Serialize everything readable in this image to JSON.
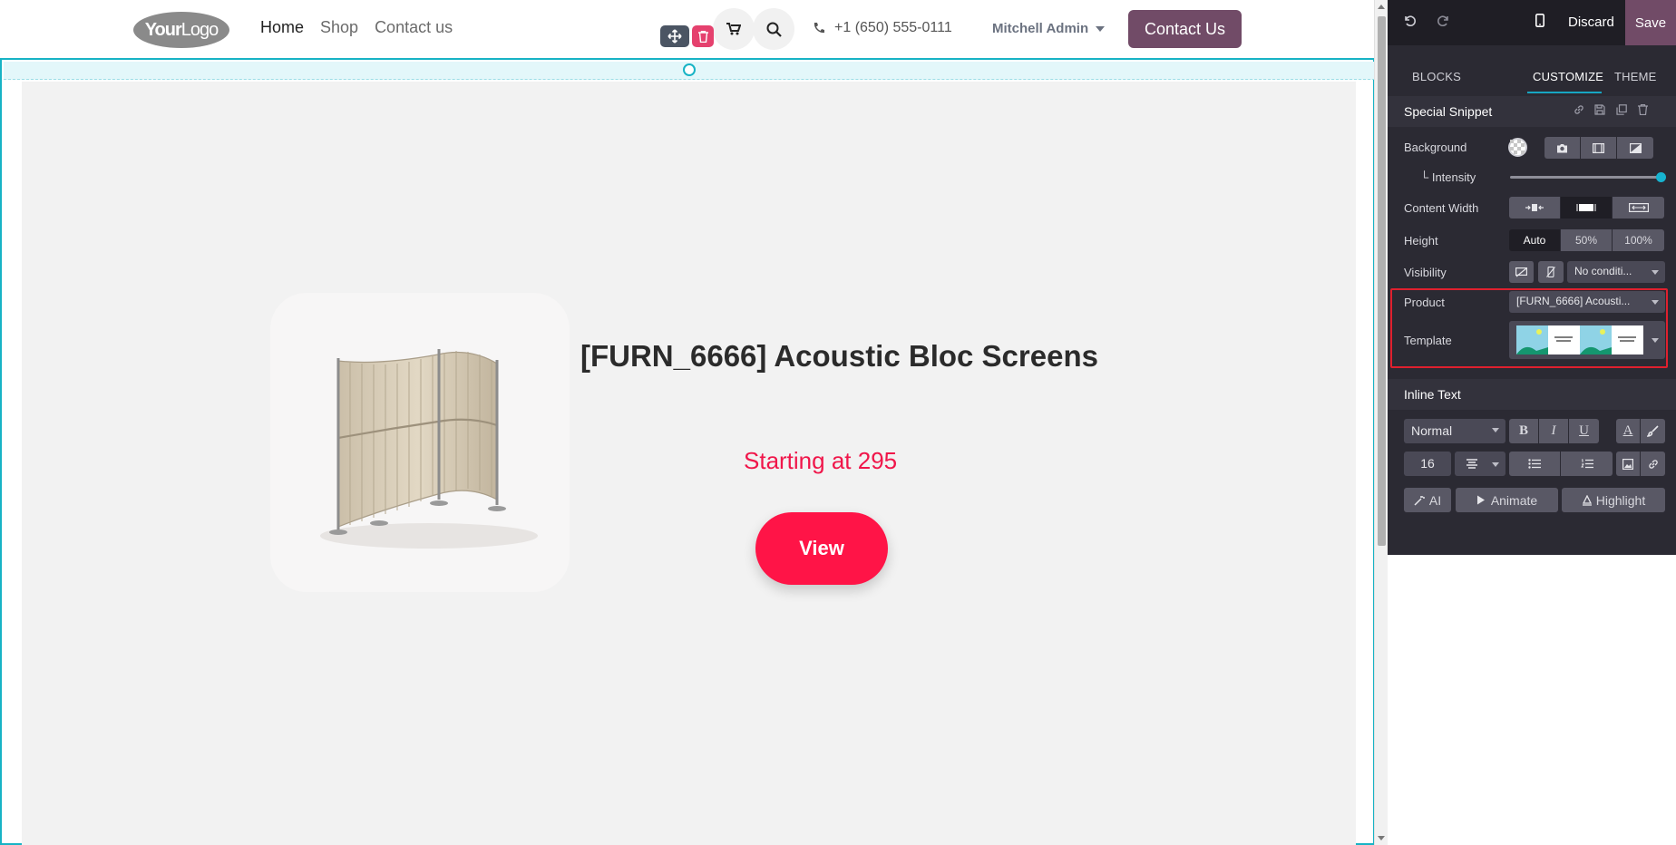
{
  "header": {
    "logo_bold": "Your",
    "logo_thin": "Logo",
    "nav": [
      "Home",
      "Shop",
      "Contact us"
    ],
    "phone": "+1 (650) 555-0111",
    "user": "Mitchell Admin",
    "cta": "Contact Us"
  },
  "product": {
    "title": "[FURN_6666] Acoustic Bloc Screens",
    "price": "Starting at 295",
    "button": "View"
  },
  "editor": {
    "discard": "Discard",
    "save": "Save",
    "tabs": [
      "BLOCKS",
      "CUSTOMIZE",
      "THEME"
    ],
    "snippet_title": "Special Snippet",
    "background_label": "Background",
    "intensity_label": "Intensity",
    "intensity_value": 1.0,
    "content_width_label": "Content Width",
    "height_label": "Height",
    "height_options": [
      "Auto",
      "50%",
      "100%"
    ],
    "visibility_label": "Visibility",
    "visibility_value": "No conditi...",
    "product_label": "Product",
    "product_value": "[FURN_6666] Acousti...",
    "template_label": "Template",
    "inline_text_title": "Inline Text",
    "text_style": "Normal",
    "font_size": "16",
    "ai_label": "AI",
    "animate_label": "Animate",
    "highlight_label": "Highlight"
  },
  "colors": {
    "accent": "#714b67",
    "product_red": "#ff1447",
    "selection": "#17b3c5"
  }
}
